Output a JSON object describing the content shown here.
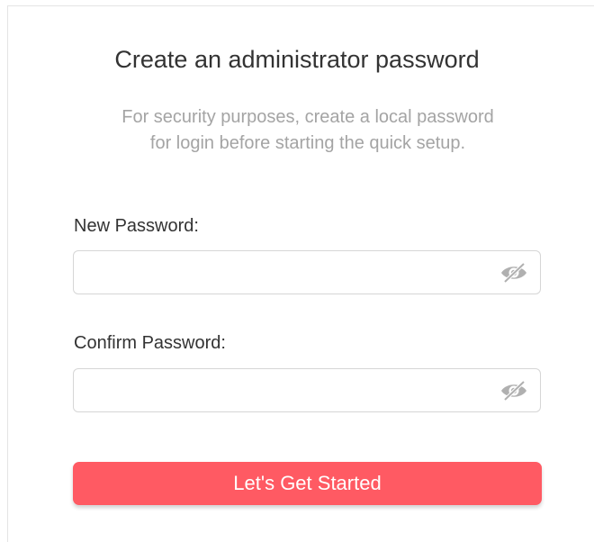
{
  "form": {
    "title": "Create an administrator password",
    "subtitle_line1": "For security purposes, create a local password",
    "subtitle_line2": "for login before starting the quick setup.",
    "new_password": {
      "label": "New Password:",
      "value": "",
      "placeholder": "",
      "visibility_icon": "eye-slash-icon"
    },
    "confirm_password": {
      "label": "Confirm Password:",
      "value": "",
      "placeholder": "",
      "visibility_icon": "eye-slash-icon"
    },
    "submit_label": "Let's Get Started"
  },
  "colors": {
    "accent": "#ff5a63",
    "text": "#333333",
    "muted": "#a4a4a4",
    "border": "#d6d6d6",
    "icon": "#a9a9a9"
  }
}
